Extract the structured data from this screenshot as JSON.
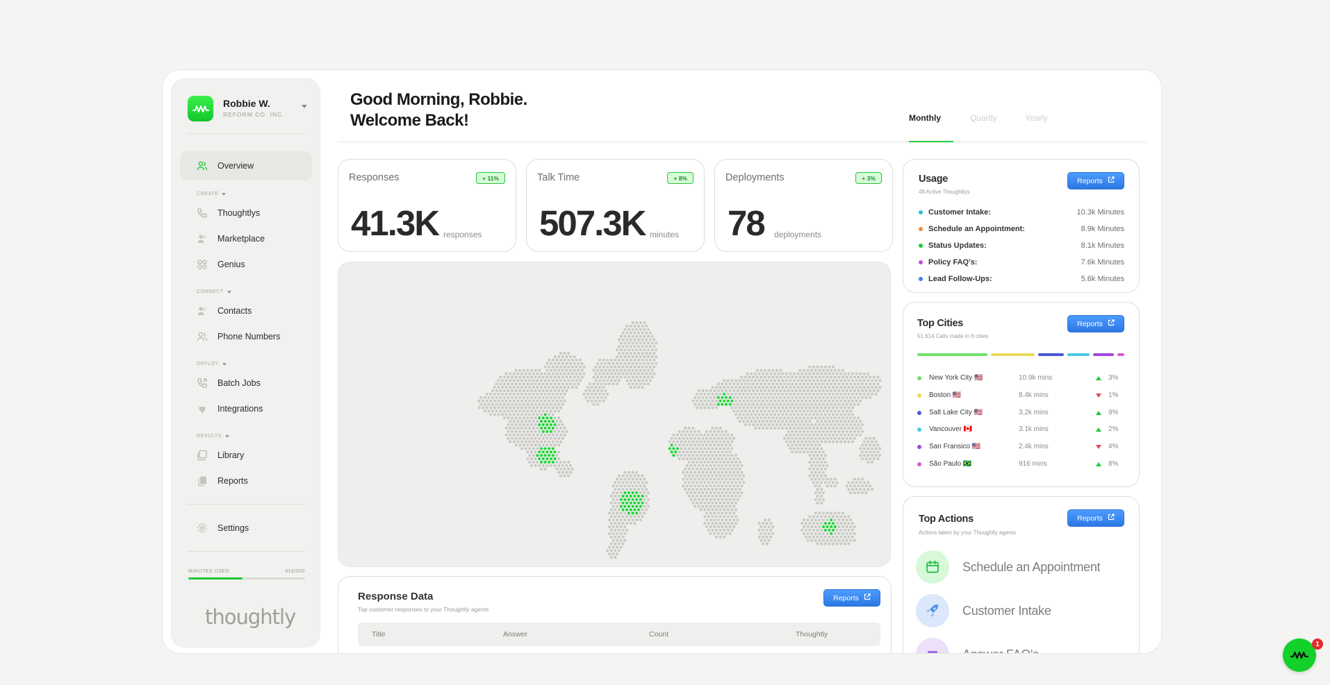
{
  "profile": {
    "name": "Robbie W.",
    "org": "REFORM CO. INC."
  },
  "nav": {
    "overview": "Overview",
    "section_create": "CREATE",
    "thoughtlys": "Thoughtlys",
    "marketplace": "Marketplace",
    "genius": "Genius",
    "section_connect": "CONNECT",
    "contacts": "Contacts",
    "phone_numbers": "Phone Numbers",
    "section_deploy": "DEPLOY",
    "batch_jobs": "Batch Jobs",
    "integrations": "Integrations",
    "section_results": "RESULTS",
    "library": "Library",
    "reports": "Reports",
    "settings": "Settings"
  },
  "minutes": {
    "label": "MINUTES USED",
    "value": "416/900",
    "fraction": 0.462
  },
  "brand": "thoughtly",
  "header": {
    "greeting_line1": "Good Morning, Robbie.",
    "greeting_line2": "Welcome Back!"
  },
  "tabs": [
    "Monthly",
    "Quartly",
    "Yearly"
  ],
  "stats": [
    {
      "title": "Responses",
      "badge": "+ 11%",
      "value": "41.3K",
      "unit": "responses"
    },
    {
      "title": "Talk Time",
      "badge": "+ 8%",
      "value": "507.3K",
      "unit": "minutes"
    },
    {
      "title": "Deployments",
      "badge": "+ 3%",
      "value": "78",
      "unit": "deployments"
    }
  ],
  "reports_label": "Reports",
  "usage": {
    "title": "Usage",
    "subtitle": "49 Active Thoughtlys",
    "rows": [
      {
        "label": "Customer Intake:",
        "value": "10.3k Minutes",
        "color": "#21c3d6"
      },
      {
        "label": "Schedule an Appointment:",
        "value": "8.9k Minutes",
        "color": "#f08a3c"
      },
      {
        "label": "Status Updates:",
        "value": "8.1k Minutes",
        "color": "#22c83c"
      },
      {
        "label": "Policy FAQ's:",
        "value": "7.6k Minutes",
        "color": "#c04fd8"
      },
      {
        "label": "Lead Follow-Ups:",
        "value": "5.6k Minutes",
        "color": "#3b7fe6"
      }
    ]
  },
  "cities": {
    "title": "Top Cities",
    "subtitle": "51,614 Calls made in 6 cities",
    "rows": [
      {
        "name": "New York City",
        "flag": "🇺🇸",
        "mins": "10.9k mins",
        "trend": "up",
        "pct": "3%",
        "color": "#6fe06a"
      },
      {
        "name": "Boston",
        "flag": "🇺🇸",
        "mins": "8.4k mins",
        "trend": "down",
        "pct": "1%",
        "color": "#e8dc5a"
      },
      {
        "name": "Salt Lake City",
        "flag": "🇺🇸",
        "mins": "3.2k mins",
        "trend": "up",
        "pct": "9%",
        "color": "#4a56d6"
      },
      {
        "name": "Vancouver",
        "flag": "🇨🇦",
        "mins": "3.1k mins",
        "trend": "up",
        "pct": "2%",
        "color": "#45c8ea"
      },
      {
        "name": "San Fransico",
        "flag": "🇺🇸",
        "mins": "2.4k mins",
        "trend": "down",
        "pct": "4%",
        "color": "#a447d8"
      },
      {
        "name": "São Paulo",
        "flag": "🇧🇷",
        "mins": "916 mins",
        "trend": "up",
        "pct": "8%",
        "color": "#d65bd6"
      }
    ]
  },
  "actions": {
    "title": "Top Actions",
    "subtitle": "Actions taken by your Thoughtly agents",
    "items": [
      "Schedule an Appointment",
      "Customer Intake",
      "Answer FAQ's"
    ]
  },
  "response_data": {
    "title": "Response Data",
    "subtitle": "Top customer responses to your Thoughtly agents",
    "columns": [
      "Title",
      "Answer",
      "Count",
      "Thoughtly"
    ]
  },
  "notification_count": "1"
}
